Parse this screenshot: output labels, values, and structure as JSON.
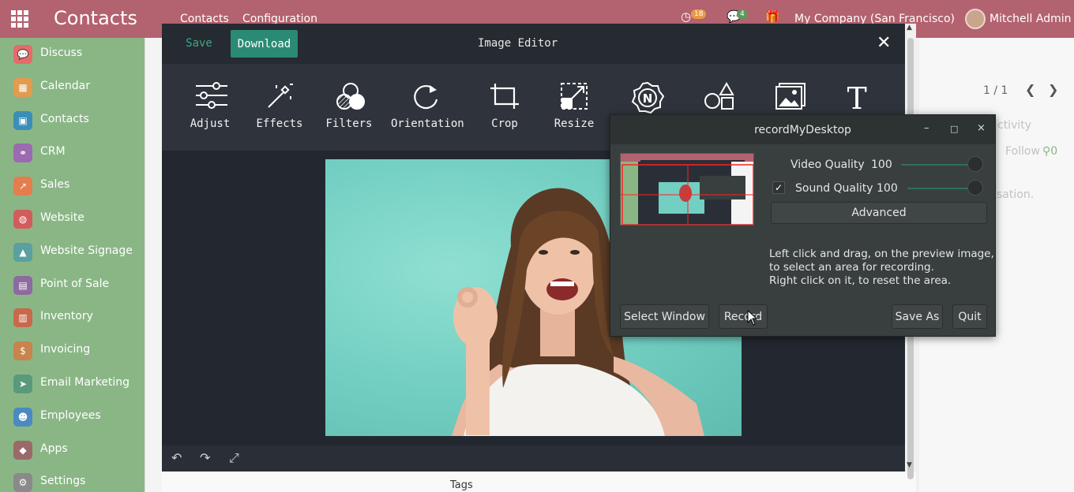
{
  "navbar": {
    "brand": "Contacts",
    "menu": [
      "Contacts",
      "Configuration"
    ],
    "activity_count": "18",
    "messages_count": "4",
    "company": "My Company (San Francisco)",
    "user": "Mitchell Admin"
  },
  "sidebar": {
    "items": [
      {
        "label": "Discuss",
        "icon": "chat-icon",
        "color": "#e56a6a"
      },
      {
        "label": "Calendar",
        "icon": "calendar-icon",
        "color": "#e39b4d"
      },
      {
        "label": "Contacts",
        "icon": "contact-card-icon",
        "color": "#3a8fb7"
      },
      {
        "label": "CRM",
        "icon": "handshake-icon",
        "color": "#9b6ab1"
      },
      {
        "label": "Sales",
        "icon": "chart-up-icon",
        "color": "#e57d4d"
      },
      {
        "label": "Website",
        "icon": "globe-icon",
        "color": "#d45b5b"
      },
      {
        "label": "Website Signage",
        "icon": "signage-icon",
        "color": "#5aa0a0"
      },
      {
        "label": "Point of Sale",
        "icon": "shop-icon",
        "color": "#8d6a9f"
      },
      {
        "label": "Inventory",
        "icon": "box-icon",
        "color": "#c86a4a"
      },
      {
        "label": "Invoicing",
        "icon": "invoice-icon",
        "color": "#c8844a"
      },
      {
        "label": "Email Marketing",
        "icon": "paper-plane-icon",
        "color": "#5a9a7a"
      },
      {
        "label": "Employees",
        "icon": "people-icon",
        "color": "#4a8ac0"
      },
      {
        "label": "Apps",
        "icon": "puzzle-icon",
        "color": "#9a6a6a"
      },
      {
        "label": "Settings",
        "icon": "gear-icon",
        "color": "#8a8a8a"
      }
    ]
  },
  "background": {
    "pager": "1 / 1",
    "activity": "ctivity",
    "follow": "Follow",
    "followers": "0",
    "sation": "sation.",
    "tags": "Tags"
  },
  "editor": {
    "save_label": "Save",
    "download_label": "Download",
    "title": "Image Editor",
    "tools": [
      {
        "label": "Adjust",
        "icon": "sliders-icon"
      },
      {
        "label": "Effects",
        "icon": "magic-wand-icon"
      },
      {
        "label": "Filters",
        "icon": "filters-icon"
      },
      {
        "label": "Orientation",
        "icon": "rotate-icon"
      },
      {
        "label": "Crop",
        "icon": "crop-icon"
      },
      {
        "label": "Resize",
        "icon": "resize-icon"
      },
      {
        "label": "",
        "icon": "badge-n-icon"
      },
      {
        "label": "",
        "icon": "shapes-icon"
      },
      {
        "label": "",
        "icon": "image-icon"
      },
      {
        "label": "",
        "icon": "text-icon"
      }
    ]
  },
  "recorder": {
    "title": "recordMyDesktop",
    "video_quality_label": "Video Quality",
    "video_quality_value": "100",
    "sound_quality_label": "Sound Quality",
    "sound_quality_value": "100",
    "sound_checked": true,
    "advanced_label": "Advanced",
    "help_line1": "Left click and drag, on the preview image,",
    "help_line2": "to select an area for recording.",
    "help_line3": "Right click on it, to reset the area.",
    "select_window_label": "Select Window",
    "record_label": "Record",
    "save_as_label": "Save As",
    "quit_label": "Quit"
  }
}
